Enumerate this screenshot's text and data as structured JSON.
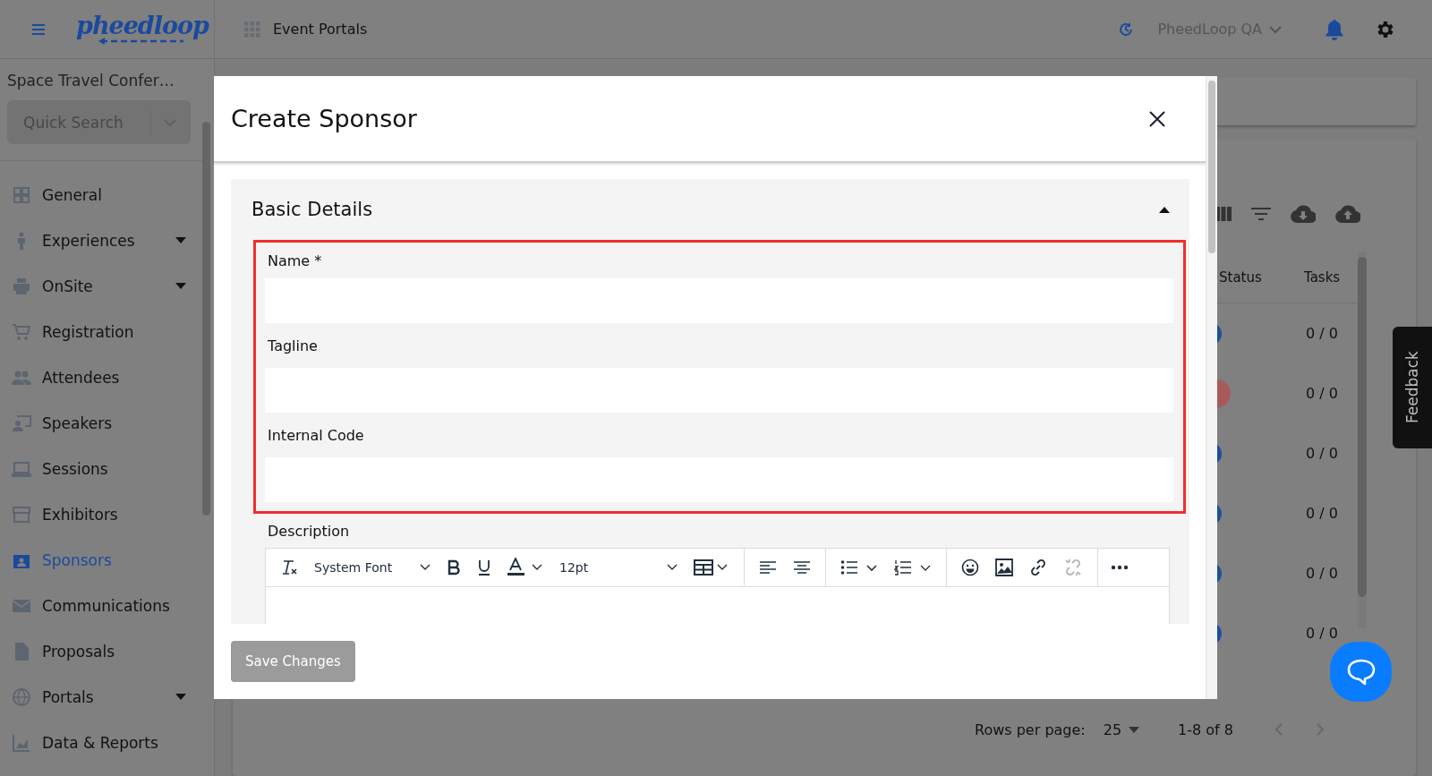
{
  "header": {
    "logo": "pheedloop",
    "app_switcher": "Event Portals",
    "account": "PheedLoop QA"
  },
  "sidebar": {
    "event_name": "Space Travel Confer…",
    "search": {
      "placeholder": "Quick Search"
    },
    "items": [
      {
        "label": "General",
        "expandable": false,
        "selected": false
      },
      {
        "label": "Experiences",
        "expandable": true,
        "selected": false
      },
      {
        "label": "OnSite",
        "expandable": true,
        "selected": false
      },
      {
        "label": "Registration",
        "expandable": false,
        "selected": false
      },
      {
        "label": "Attendees",
        "expandable": false,
        "selected": false
      },
      {
        "label": "Speakers",
        "expandable": false,
        "selected": false
      },
      {
        "label": "Sessions",
        "expandable": false,
        "selected": false
      },
      {
        "label": "Exhibitors",
        "expandable": false,
        "selected": false
      },
      {
        "label": "Sponsors",
        "expandable": false,
        "selected": true
      },
      {
        "label": "Communications",
        "expandable": false,
        "selected": false
      },
      {
        "label": "Proposals",
        "expandable": false,
        "selected": false
      },
      {
        "label": "Portals",
        "expandable": true,
        "selected": false
      },
      {
        "label": "Data & Reports",
        "expandable": false,
        "selected": false
      }
    ]
  },
  "table": {
    "columns": [
      "Status",
      "Tasks"
    ],
    "rows": [
      {
        "color": "#1a4fa0",
        "tasks": "0 / 0"
      },
      {
        "color": "#a85a5a",
        "tasks": "0 / 0"
      },
      {
        "color": "#1a4fa0",
        "tasks": "0 / 0"
      },
      {
        "color": "#1a4fa0",
        "tasks": "0 / 0"
      },
      {
        "color": "#1a4fa0",
        "tasks": "0 / 0"
      },
      {
        "color": "#1a4fa0",
        "tasks": "0 / 0"
      }
    ]
  },
  "pagination": {
    "rows_per_page_label": "Rows per page:",
    "rows_per_page": "25",
    "range": "1-8 of 8"
  },
  "feedback_tab": "Feedback",
  "modal": {
    "title": "Create Sponsor",
    "section": {
      "title": "Basic Details",
      "expanded": true,
      "highlighted": true,
      "fields": [
        {
          "label": "Name *"
        },
        {
          "label": "Tagline"
        },
        {
          "label": "Internal Code"
        }
      ]
    },
    "description": {
      "label": "Description",
      "font": "System Font",
      "size": "12pt",
      "unlink_disabled": true
    },
    "save_button": {
      "label": "Save Changes",
      "disabled": true
    }
  }
}
